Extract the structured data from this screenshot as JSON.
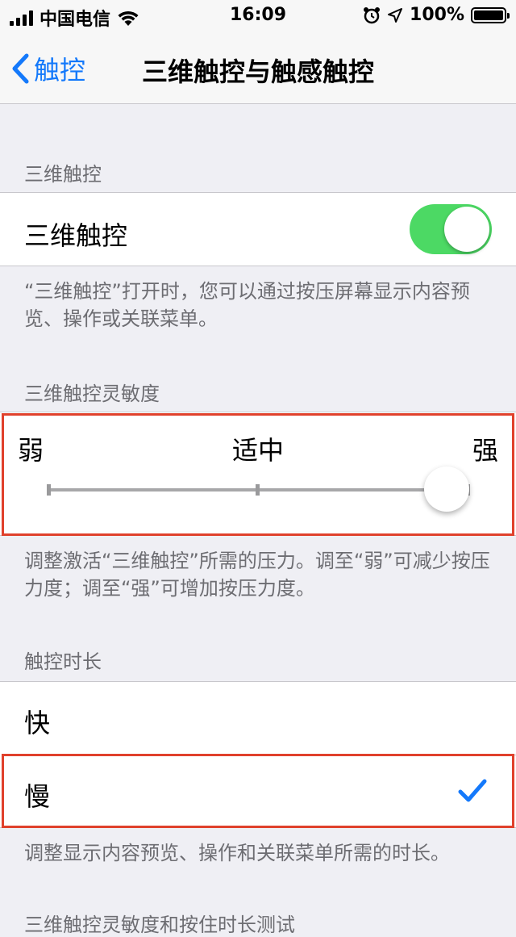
{
  "status_bar": {
    "carrier": "中国电信",
    "time": "16:09",
    "battery": "100%"
  },
  "nav": {
    "back_label": "触控",
    "title": "三维触控与触感触控"
  },
  "section_3d": {
    "header": "三维触控",
    "toggle_label": "三维触控",
    "toggle_on": true,
    "footer": "“三维触控”打开时，您可以通过按压屏幕显示内容预览、操作或关联菜单。"
  },
  "sensitivity": {
    "header": "三维触控灵敏度",
    "label_low": "弱",
    "label_mid": "适中",
    "label_high": "强",
    "value": "强",
    "footer": "调整激活“三维触控”所需的压力。调至“弱”可减少按压力度；调至“强”可增加按压力度。"
  },
  "duration": {
    "header": "触控时长",
    "options": [
      "快",
      "慢"
    ],
    "selected": "慢",
    "footer": "调整显示内容预览、操作和关联菜单所需的时长。"
  },
  "next_header": "三维触控灵敏度和按住时长测试",
  "colors": {
    "accent": "#1479fb",
    "toggle_on": "#4cd964",
    "highlight": "#e0412c"
  }
}
